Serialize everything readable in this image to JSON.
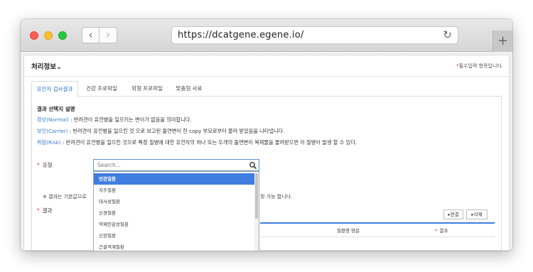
{
  "browser": {
    "url": "https://dcatgene.egene.io/",
    "back_glyph": "‹",
    "forward_glyph": "›",
    "reload_glyph": "↻",
    "newtab_glyph": "+"
  },
  "section": {
    "title": "처리정보",
    "toggle_glyph": "⌄",
    "required_note": "필수입력 항목입니다.",
    "required_star": "*"
  },
  "tabs": [
    {
      "label": "유전자 검사결과",
      "active": true
    },
    {
      "label": "건강 프로파일",
      "active": false
    },
    {
      "label": "외형 프로파일",
      "active": false
    },
    {
      "label": "맞춤형 사료",
      "active": false
    }
  ],
  "description": {
    "title": "결과 선택지 설명",
    "lines": [
      {
        "term": "정상(Normal)",
        "text": " : 반려견이 유전병을 일으키는 변이가 없음을 의미합니다."
      },
      {
        "term": "보인(Carrier)",
        "text": " : 반려견이 유전병을 일으킨 것 으로 보고된 돌연변이 한 copy 부모로부터 물려 받았음을 나타냅니다."
      },
      {
        "term": "위험(Risk)",
        "text": " : 반려견이 유전병을 일으킨 것으로 특정 질병에 대한 유전자의 하나 또는 두개의 돌연변이 복제물을 물려받으면 이 질병이 발생 할 수 있다."
      }
    ]
  },
  "form": {
    "type_label": "유형",
    "result_label": "결과",
    "star": "*",
    "search_placeholder": "Search...",
    "search_value": "",
    "dropdown_options": [
      "연관질환",
      "치주질환",
      "대사성질환",
      "신경질환",
      "악제민감성질환",
      "신장질환",
      "근골격계질환"
    ],
    "selected_option": "연관질환",
    "note_left": "※ 결과는 기본값으로",
    "note_right": "정 가능 합니다."
  },
  "table": {
    "add_button": "▸연결",
    "delete_button": "▸삭제",
    "columns": [
      "질환명 영문",
      "결과"
    ]
  },
  "colors": {
    "accent": "#3f7de0",
    "link": "#3a7dc9",
    "required": "#ee3322"
  }
}
